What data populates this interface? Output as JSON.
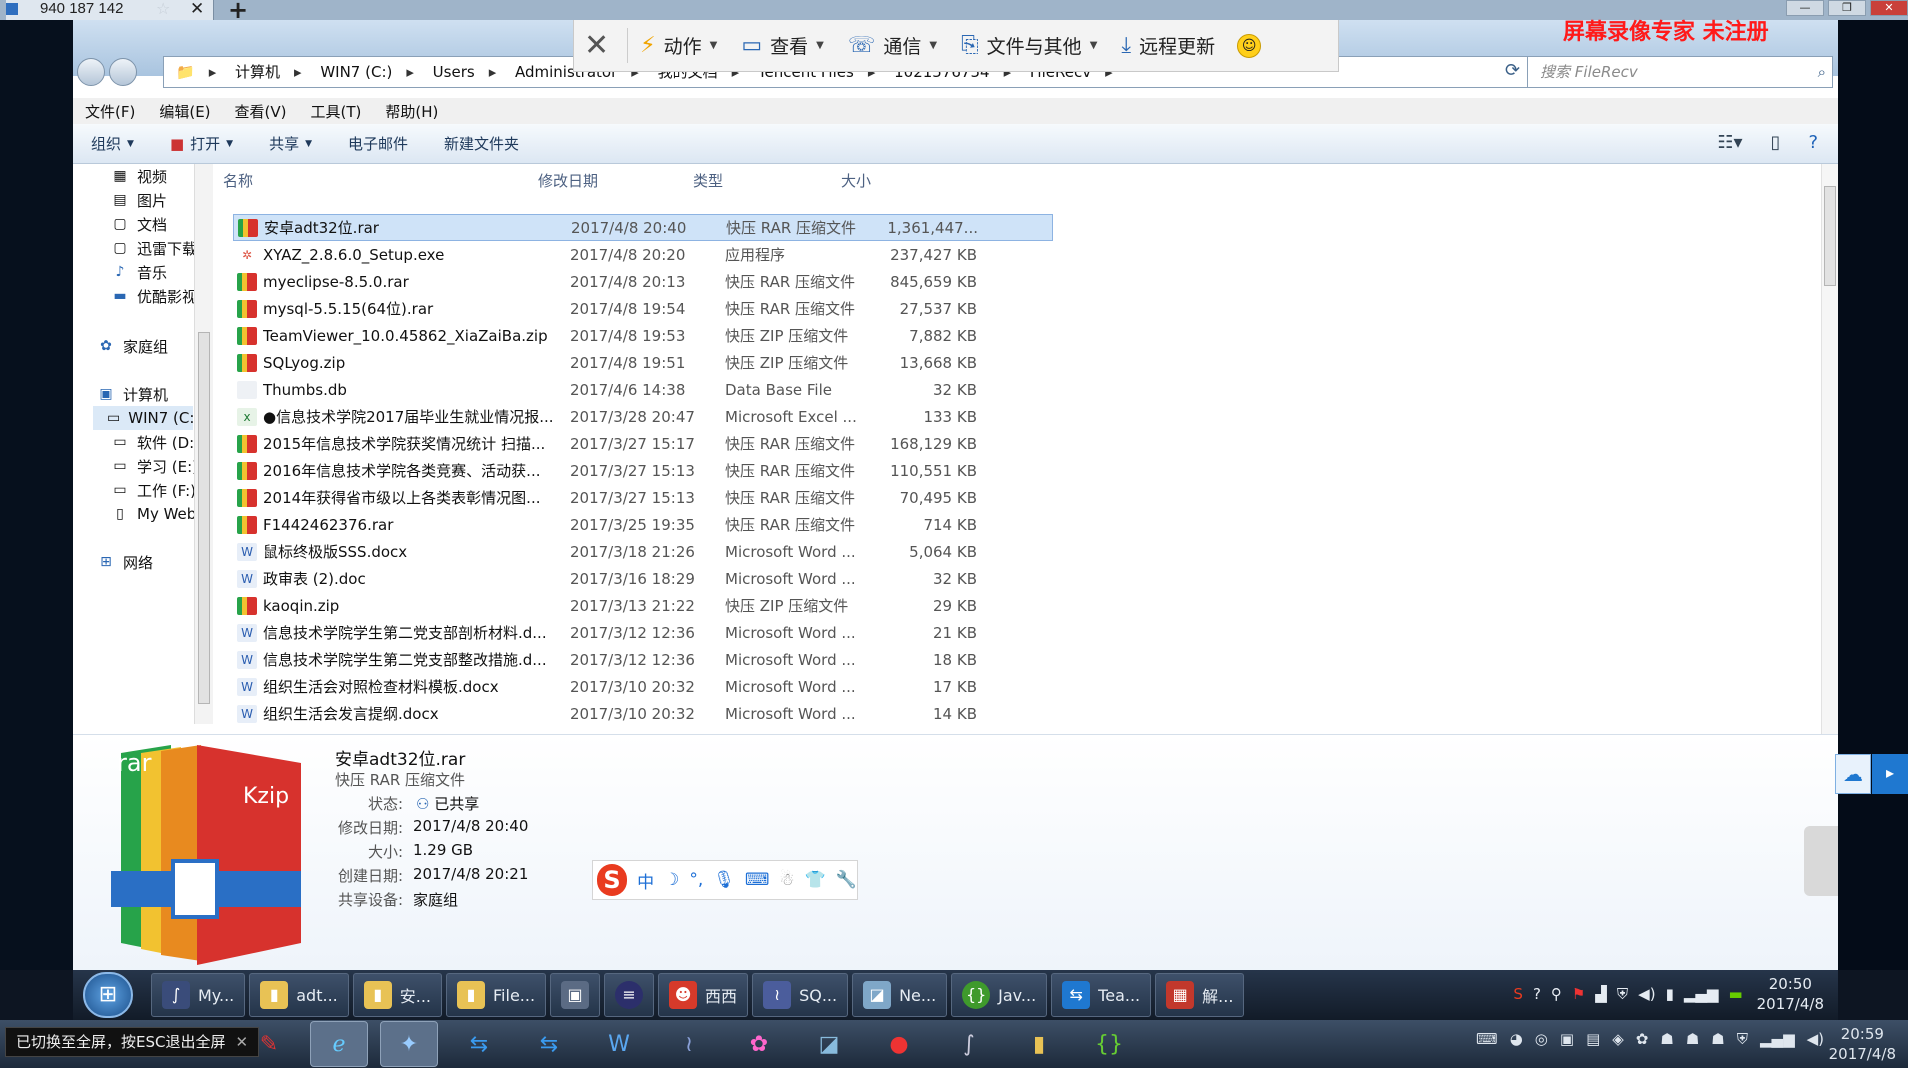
{
  "outer_tab": {
    "title": "940 187 142"
  },
  "watermark": "屏幕录像专家 未注册",
  "tv_toolbar": {
    "items": [
      {
        "label": "动作",
        "icon": "lightning-icon"
      },
      {
        "label": "查看",
        "icon": "monitor-icon"
      },
      {
        "label": "通信",
        "icon": "phone-icon"
      },
      {
        "label": "文件与其他",
        "icon": "file-transfer-icon"
      },
      {
        "label": "远程更新",
        "icon": "download-icon"
      }
    ]
  },
  "address": {
    "segments": [
      "计算机",
      "WIN7 (C:)",
      "Users",
      "Administrator",
      "我的文档",
      "Tencent Files",
      "1021576754",
      "FileRecv"
    ],
    "search_placeholder": "搜索 FileRecv"
  },
  "menu": [
    "文件(F)",
    "编辑(E)",
    "查看(V)",
    "工具(T)",
    "帮助(H)"
  ],
  "commands": [
    "组织",
    "打开",
    "共享",
    "电子邮件",
    "新建文件夹"
  ],
  "nav": {
    "libraries": [
      "视频",
      "图片",
      "文档",
      "迅雷下载",
      "音乐",
      "优酷影视"
    ],
    "homegroup": "家庭组",
    "computer": "计算机",
    "drives": [
      "WIN7 (C:)",
      "软件 (D:)",
      "学习 (E:)",
      "工作 (F:)",
      "My Web"
    ],
    "network": "网络"
  },
  "columns": {
    "name": "名称",
    "date": "修改日期",
    "type": "类型",
    "size": "大小"
  },
  "files": [
    {
      "name": "安卓adt32位.rar",
      "date": "2017/4/8 20:40",
      "type": "快压 RAR 压缩文件",
      "size": "1,361,447...",
      "icon": "rar"
    },
    {
      "name": "XYAZ_2.8.6.0_Setup.exe",
      "date": "2017/4/8 20:20",
      "type": "应用程序",
      "size": "237,427 KB",
      "icon": "exe"
    },
    {
      "name": "myeclipse-8.5.0.rar",
      "date": "2017/4/8 20:13",
      "type": "快压 RAR 压缩文件",
      "size": "845,659 KB",
      "icon": "rar"
    },
    {
      "name": "mysql-5.5.15(64位).rar",
      "date": "2017/4/8 19:54",
      "type": "快压 RAR 压缩文件",
      "size": "27,537 KB",
      "icon": "rar"
    },
    {
      "name": "TeamViewer_10.0.45862_XiaZaiBa.zip",
      "date": "2017/4/8 19:53",
      "type": "快压 ZIP 压缩文件",
      "size": "7,882 KB",
      "icon": "rar"
    },
    {
      "name": "SQLyog.zip",
      "date": "2017/4/8 19:51",
      "type": "快压 ZIP 压缩文件",
      "size": "13,668 KB",
      "icon": "rar"
    },
    {
      "name": "Thumbs.db",
      "date": "2017/4/6 14:38",
      "type": "Data Base File",
      "size": "32 KB",
      "icon": "db"
    },
    {
      "name": "●信息技术学院2017届毕业生就业情况报...",
      "date": "2017/3/28 20:47",
      "type": "Microsoft Excel ...",
      "size": "133 KB",
      "icon": "xls"
    },
    {
      "name": "2015年信息技术学院获奖情况统计 扫描...",
      "date": "2017/3/27 15:17",
      "type": "快压 RAR 压缩文件",
      "size": "168,129 KB",
      "icon": "rar"
    },
    {
      "name": "2016年信息技术学院各类竞赛、活动获...",
      "date": "2017/3/27 15:13",
      "type": "快压 RAR 压缩文件",
      "size": "110,551 KB",
      "icon": "rar"
    },
    {
      "name": "2014年获得省市级以上各类表彰情况图...",
      "date": "2017/3/27 15:13",
      "type": "快压 RAR 压缩文件",
      "size": "70,495 KB",
      "icon": "rar"
    },
    {
      "name": "F1442462376.rar",
      "date": "2017/3/25 19:35",
      "type": "快压 RAR 压缩文件",
      "size": "714 KB",
      "icon": "rar"
    },
    {
      "name": "鼠标终极版SSS.docx",
      "date": "2017/3/18 21:26",
      "type": "Microsoft Word ...",
      "size": "5,064 KB",
      "icon": "doc"
    },
    {
      "name": "政审表 (2).doc",
      "date": "2017/3/16 18:29",
      "type": "Microsoft Word ...",
      "size": "32 KB",
      "icon": "doc"
    },
    {
      "name": "kaoqin.zip",
      "date": "2017/3/13 21:22",
      "type": "快压 ZIP 压缩文件",
      "size": "29 KB",
      "icon": "rar"
    },
    {
      "name": "信息技术学院学生第二党支部剖析材料.d...",
      "date": "2017/3/12 12:36",
      "type": "Microsoft Word ...",
      "size": "21 KB",
      "icon": "doc"
    },
    {
      "name": "信息技术学院学生第二党支部整改措施.d...",
      "date": "2017/3/12 12:36",
      "type": "Microsoft Word ...",
      "size": "18 KB",
      "icon": "doc"
    },
    {
      "name": "组织生活会对照检查材料模板.docx",
      "date": "2017/3/10 20:32",
      "type": "Microsoft Word ...",
      "size": "17 KB",
      "icon": "doc"
    },
    {
      "name": "组织生活会发言提纲.docx",
      "date": "2017/3/10 20:32",
      "type": "Microsoft Word ...",
      "size": "14 KB",
      "icon": "doc"
    }
  ],
  "details": {
    "icon_labels": {
      "rar": "rar",
      "kzip": "Kzip"
    },
    "title": "安卓adt32位.rar",
    "type": "快压 RAR 压缩文件",
    "fields": [
      {
        "label": "状态:",
        "value": "已共享"
      },
      {
        "label": "修改日期:",
        "value": "2017/4/8 20:40"
      },
      {
        "label": "大小:",
        "value": "1.29 GB"
      },
      {
        "label": "创建日期:",
        "value": "2017/4/8 20:21"
      },
      {
        "label": "共享设备:",
        "value": "家庭组"
      }
    ]
  },
  "ime_bar": {
    "mode": "中"
  },
  "inner_taskbar": {
    "buttons": [
      "My...",
      "adt...",
      "安...",
      "File...",
      "",
      "",
      "西西",
      "SQ...",
      "Ne...",
      "Jav...",
      "Tea...",
      "解..."
    ],
    "clock_time": "20:50",
    "clock_date": "2017/4/8"
  },
  "outer_taskbar": {
    "clock_time": "20:59",
    "clock_date": "2017/4/8"
  },
  "esc_tip": "已切换至全屏，按ESC退出全屏"
}
